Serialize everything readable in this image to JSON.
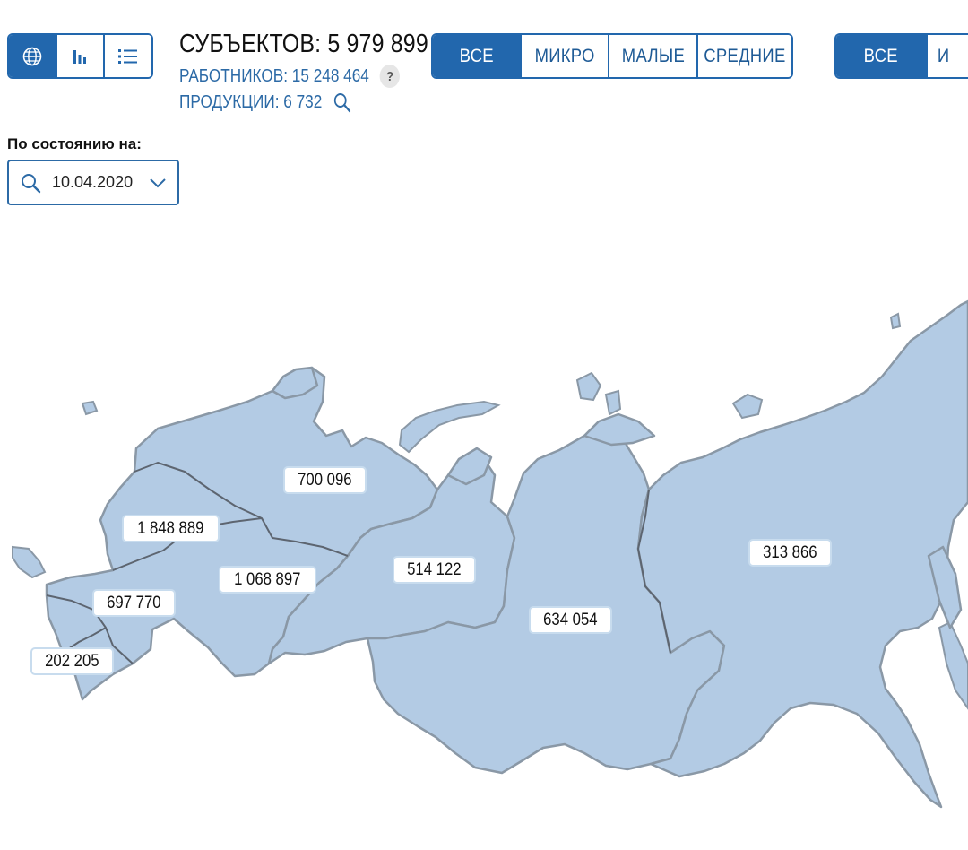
{
  "view_switch": {
    "items": [
      {
        "name": "map-view-button",
        "icon": "globe-icon",
        "active": true
      },
      {
        "name": "chart-view-button",
        "icon": "bar-chart-icon",
        "active": false
      },
      {
        "name": "list-view-button",
        "icon": "list-icon",
        "active": false
      }
    ]
  },
  "stats": {
    "subjects": "СУБЪЕКТОВ: 5 979 899",
    "workers": "РАБОТНИКОВ: 15 248 464",
    "products": "ПРОДУКЦИИ: 6 732",
    "help_symbol": "?"
  },
  "size_filter": {
    "options": [
      "ВСЕ",
      "МИКРО",
      "МАЛЫЕ",
      "СРЕДНИЕ"
    ],
    "selected": "ВСЕ"
  },
  "type_filter": {
    "options": [
      "ВСЕ",
      "И"
    ],
    "selected": "ВСЕ"
  },
  "date": {
    "label": "По состоянию на:",
    "value": "10.04.2020"
  },
  "map": {
    "region_fill": "#b3cbe4",
    "labels": [
      {
        "id": "northwest",
        "value": "700 096"
      },
      {
        "id": "central",
        "value": "1 848 889"
      },
      {
        "id": "volga",
        "value": "1 068 897"
      },
      {
        "id": "ural",
        "value": "514 122"
      },
      {
        "id": "south",
        "value": "697 770"
      },
      {
        "id": "north-caucasus",
        "value": "202 205"
      },
      {
        "id": "siberia",
        "value": "634 054"
      },
      {
        "id": "far-east",
        "value": "313 866"
      }
    ]
  },
  "colors": {
    "accent": "#2267ad",
    "accent_text": "#2c6aa6"
  }
}
